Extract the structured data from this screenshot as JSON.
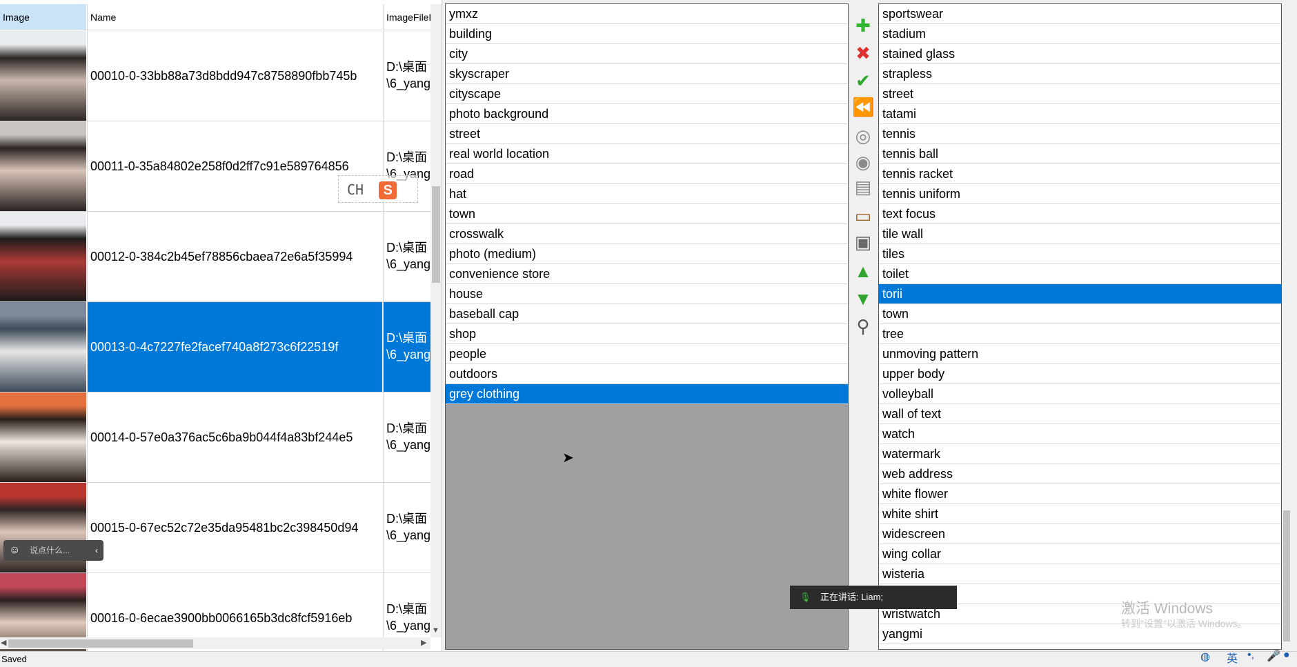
{
  "grid": {
    "headers": {
      "image": "Image",
      "name": "Name",
      "path": "ImageFileP"
    },
    "rows": [
      {
        "name": "00010-0-33bb88a73d8bdd947c8758890fbb745b",
        "path1": "D:\\桌面",
        "path2": "\\6_yang",
        "selected": false,
        "thumb": [
          "#e9ecef",
          "#2b2523",
          "#c9b8ae"
        ]
      },
      {
        "name": "00011-0-35a84802e258f0d2ff7c91e589764856",
        "path1": "D:\\桌面",
        "path2": "\\6_yang",
        "selected": false,
        "thumb": [
          "#c9c6c2",
          "#2a2322",
          "#d8c4b8"
        ]
      },
      {
        "name": "00012-0-384c2b45ef78856cbaea72e6a5f35994",
        "path1": "D:\\桌面",
        "path2": "\\6_yang",
        "selected": false,
        "thumb": [
          "#e9ebee",
          "#1e1b1b",
          "#a93b35"
        ]
      },
      {
        "name": "00013-0-4c7227fe2facef740a8f273c6f22519f",
        "path1": "D:\\桌面",
        "path2": "\\6_yang",
        "selected": true,
        "thumb": [
          "#7c8a99",
          "#3e4a5a",
          "#e6e6e6"
        ]
      },
      {
        "name": "00014-0-57e0a376ac5c6ba9b044f4a83bf244e5",
        "path1": "D:\\桌面",
        "path2": "\\6_yang",
        "selected": false,
        "thumb": [
          "#e4703f",
          "#2a1f1a",
          "#ece6df"
        ]
      },
      {
        "name": "00015-0-67ec52c72e35da95481bc2c398450d94",
        "path1": "D:\\桌面",
        "path2": "\\6_yang",
        "selected": false,
        "thumb": [
          "#b9372f",
          "#2d2422",
          "#dcc6b9"
        ]
      },
      {
        "name": "00016-0-6ecae3900bb0066165b3dc8fcf5916eb",
        "path1": "D:\\桌面",
        "path2": "\\6_yang",
        "selected": false,
        "thumb": [
          "#c24858",
          "#2a2120",
          "#e0cabc"
        ]
      }
    ]
  },
  "overlays": {
    "ime": "CH",
    "ime_icon": "S",
    "chat_placeholder": "说点什么...",
    "speaking": "正在讲话: Liam;",
    "win_watermark": "激活 Windows",
    "win_watermark_sub": "转到\"设置\"以激活 Windows。",
    "tray_lang": "英"
  },
  "left_tags": [
    "ymxz",
    "building",
    "city",
    "skyscraper",
    "cityscape",
    "photo background",
    "street",
    "real world location",
    "road",
    "hat",
    "town",
    "crosswalk",
    "photo (medium)",
    "convenience store",
    "house",
    "baseball cap",
    "shop",
    "people",
    "outdoors",
    "grey clothing"
  ],
  "left_selected": 19,
  "right_tags": [
    "sportswear",
    "stadium",
    "stained glass",
    "strapless",
    "street",
    "tatami",
    "tennis",
    "tennis ball",
    "tennis racket",
    "tennis uniform",
    "text focus",
    "tile wall",
    "tiles",
    "toilet",
    "torii",
    "town",
    "tree",
    "unmoving pattern",
    "upper body",
    "volleyball",
    "wall of text",
    "watch",
    "watermark",
    "web address",
    "white flower",
    "white shirt",
    "widescreen",
    "wing collar",
    "wisteria",
    "",
    "wristwatch",
    "yangmi"
  ],
  "right_selected": 14,
  "toolbar": [
    {
      "name": "add-icon",
      "glyph": "✚",
      "color": "#2fb52f"
    },
    {
      "name": "delete-icon",
      "glyph": "✖",
      "color": "#e03030"
    },
    {
      "name": "confirm-icon",
      "glyph": "✔",
      "color": "#2fa52f"
    },
    {
      "name": "rewind-icon",
      "glyph": "⏪",
      "color": "#2a78d6"
    },
    {
      "name": "disc-icon",
      "glyph": "◎",
      "color": "#8a8a8a"
    },
    {
      "name": "disc-add-icon",
      "glyph": "◉",
      "color": "#8a8a8a"
    },
    {
      "name": "disc-stack-icon",
      "glyph": "▤",
      "color": "#8a8a8a"
    },
    {
      "name": "clipboard-icon",
      "glyph": "▭",
      "color": "#a0622b"
    },
    {
      "name": "printer-icon",
      "glyph": "▣",
      "color": "#6a6a6a"
    },
    {
      "name": "arrow-up-icon",
      "glyph": "▲",
      "color": "#2fa52f"
    },
    {
      "name": "arrow-down-icon",
      "glyph": "▼",
      "color": "#2fa52f"
    },
    {
      "name": "search-icon",
      "glyph": "⚲",
      "color": "#555555"
    }
  ],
  "status": {
    "text": "Saved"
  }
}
